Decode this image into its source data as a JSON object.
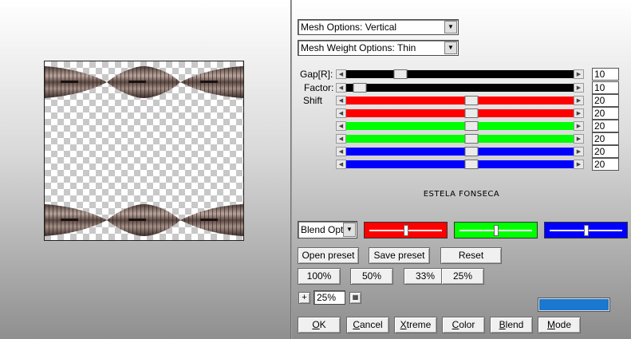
{
  "options": {
    "mesh": "Mesh Options: Vertical",
    "weight": "Mesh Weight Options: Thin"
  },
  "sliders": [
    {
      "label": "Gap[R]:",
      "value": 10,
      "fraction": 0.24,
      "color": "#000000"
    },
    {
      "label": "Factor:",
      "value": 10,
      "fraction": 0.06,
      "color": "#000000"
    },
    {
      "label": "Shift",
      "value": 20,
      "fraction": 0.55,
      "color": "#ff0000"
    },
    {
      "label": "",
      "value": 20,
      "fraction": 0.55,
      "color": "#ff0000"
    },
    {
      "label": "",
      "value": 20,
      "fraction": 0.55,
      "color": "#00ff00"
    },
    {
      "label": "",
      "value": 20,
      "fraction": 0.55,
      "color": "#00ff00"
    },
    {
      "label": "",
      "value": 20,
      "fraction": 0.55,
      "color": "#0000ff"
    },
    {
      "label": "",
      "value": 20,
      "fraction": 0.55,
      "color": "#0000ff"
    }
  ],
  "credit": "ESTELA FONSECA",
  "blend": {
    "label": "Blend Optio",
    "swatches": [
      {
        "color": "#ff0000",
        "fraction": 0.5
      },
      {
        "color": "#00ff00",
        "fraction": 0.5
      },
      {
        "color": "#0000ff",
        "fraction": 0.5
      }
    ]
  },
  "presets": {
    "open": "Open preset",
    "save": "Save preset",
    "reset": "Reset"
  },
  "zoom": {
    "options": [
      "100%",
      "50%",
      "33%",
      "25%"
    ],
    "plus": "+",
    "value": "25%"
  },
  "progress_color": "#1a78d0",
  "buttons": {
    "ok": {
      "u": "O",
      "rest": "K"
    },
    "cancel": {
      "u": "C",
      "rest": "ancel"
    },
    "xtreme": {
      "u": "X",
      "rest": "treme"
    },
    "color": {
      "u": "C",
      "rest": "olor"
    },
    "blend": {
      "u": "B",
      "rest": "lend"
    },
    "mode": {
      "u": "M",
      "rest": "ode"
    }
  }
}
